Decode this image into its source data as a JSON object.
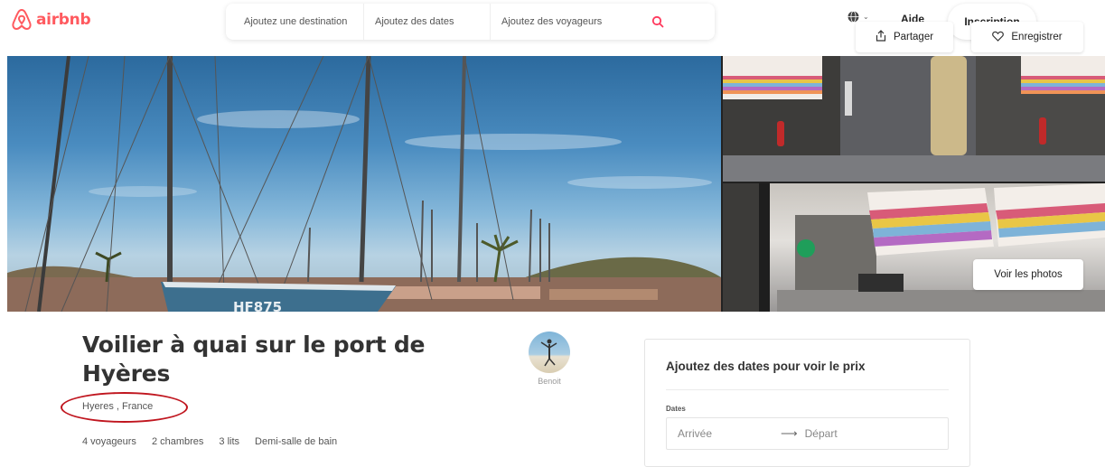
{
  "header": {
    "brand": "airbnb",
    "search": {
      "destination": "Ajoutez une destination",
      "dates": "Ajoutez des dates",
      "guests": "Ajoutez des voyageurs"
    },
    "help": "Aide",
    "signup": "Inscription"
  },
  "photos": {
    "share": "Partager",
    "save": "Enregistrer",
    "view_photos": "Voir les photos"
  },
  "listing": {
    "title": "Voilier à quai sur le port de Hyères",
    "location": "Hyeres , France",
    "details": [
      "4 voyageurs",
      "2 chambres",
      "3 lits",
      "Demi-salle de bain"
    ]
  },
  "host": {
    "name": "Benoit"
  },
  "booking": {
    "title": "Ajoutez des dates pour voir le prix",
    "dates_label": "Dates",
    "arrival": "Arrivée",
    "departure": "Départ"
  },
  "colors": {
    "brand": "#ff5a5f",
    "annotation": "#c0161f"
  },
  "icons": [
    "airbnb-logo-icon",
    "search-icon",
    "globe-icon",
    "chevron-down-icon",
    "share-icon",
    "heart-icon",
    "arrow-right-icon"
  ]
}
